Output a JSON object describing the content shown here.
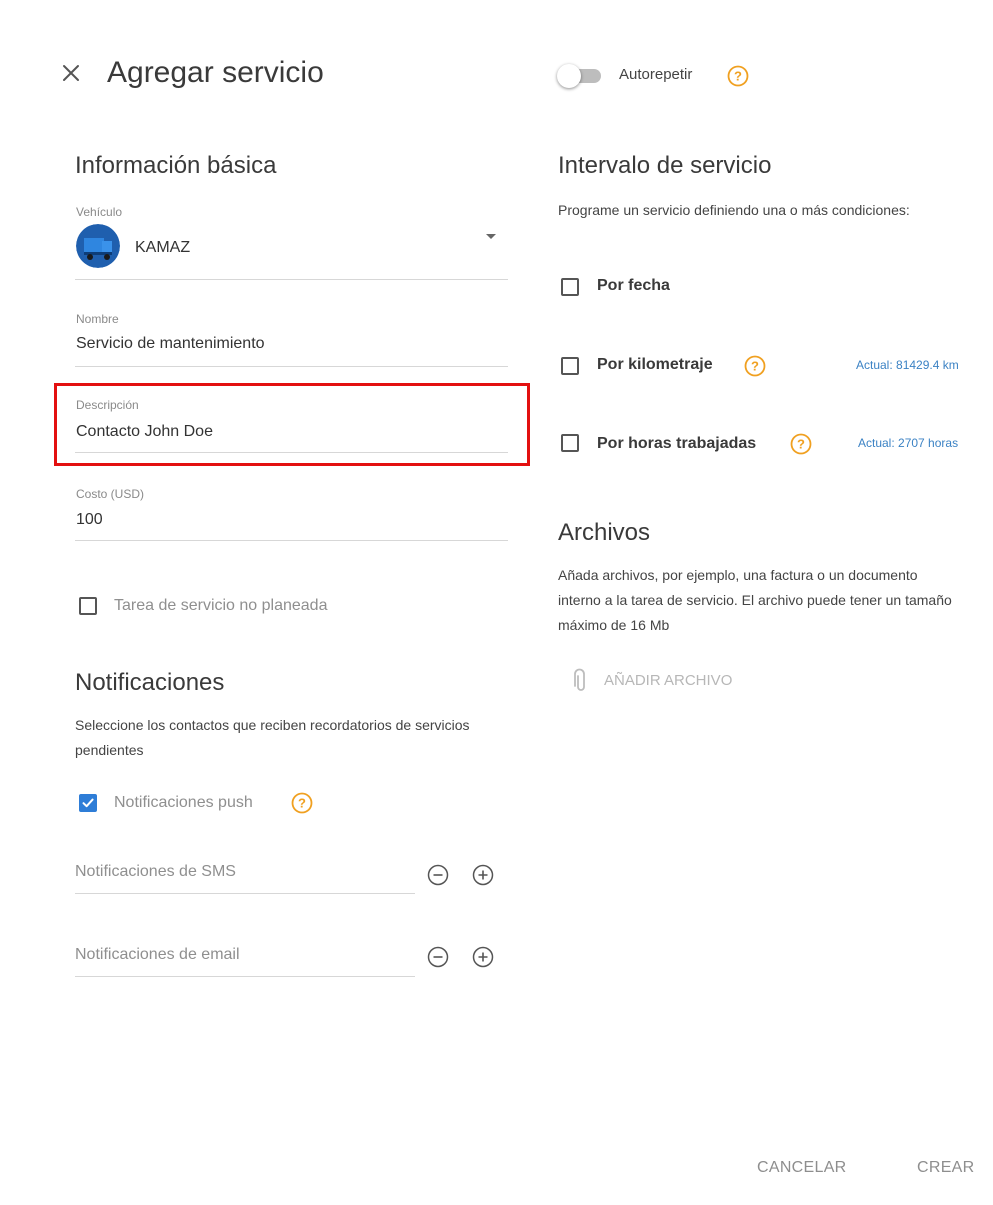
{
  "header": {
    "title": "Agregar servicio",
    "autorepeat_label": "Autorepetir"
  },
  "basic_info": {
    "heading": "Información básica",
    "vehicle": {
      "label": "Vehículo",
      "value": "KAMAZ"
    },
    "name": {
      "label": "Nombre",
      "value": "Servicio de mantenimiento"
    },
    "description": {
      "label": "Descripción",
      "value": "Contacto John Doe"
    },
    "cost": {
      "label": "Costo (USD)",
      "value": "100"
    },
    "unplanned_label": "Tarea de servicio no planeada"
  },
  "notifications": {
    "heading": "Notificaciones",
    "description": "Seleccione los contactos que reciben recordatorios de servicios pendientes",
    "push_label": "Notificaciones push",
    "sms_placeholder": "Notificaciones de SMS",
    "email_placeholder": "Notificaciones de email"
  },
  "service_interval": {
    "heading": "Intervalo de servicio",
    "description": "Programe un servicio definiendo una o más condiciones:",
    "by_date": "Por fecha",
    "by_mileage": "Por kilometraje",
    "mileage_current": "Actual: 81429.4 km",
    "by_hours": "Por horas trabajadas",
    "hours_current": "Actual: 2707 horas"
  },
  "files": {
    "heading": "Archivos",
    "description": "Añada archivos, por ejemplo, una factura o un documento interno a la tarea de servicio. El archivo puede tener un tamaño máximo de 16 Mb",
    "add_label": "AÑADIR ARCHIVO"
  },
  "footer": {
    "cancel_label": "CANCELAR",
    "create_label": "CREAR"
  },
  "colors": {
    "accent": "#2e7dd7",
    "help": "#f0a020",
    "highlight": "#e31010",
    "link": "#3b82c4"
  }
}
